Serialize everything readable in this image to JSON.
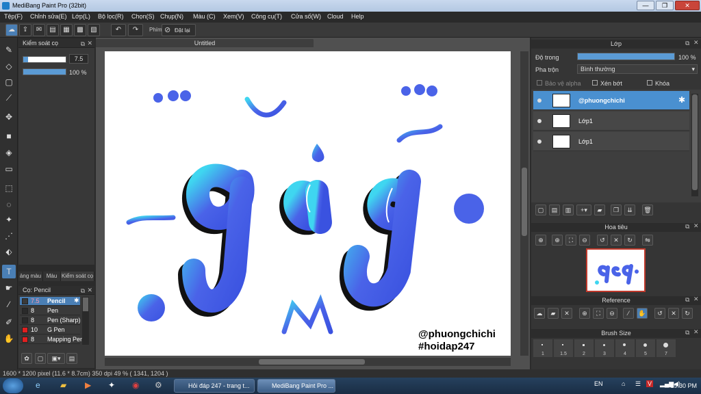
{
  "app": {
    "title": "MediBang Paint Pro (32bit)",
    "window_buttons": [
      "—",
      "❐",
      "✕"
    ]
  },
  "menu": [
    "Tệp(F)",
    "Chỉnh sửa(E)",
    "Lớp(L)",
    "Bộ lọc(R)",
    "Chọn(S)",
    "Chụp(N)",
    "Màu (C)",
    "Xem(V)",
    "Công cụ(T)",
    "Cửa số(W)",
    "Cloud",
    "Help"
  ],
  "toolbar": {
    "phim_label": "Phím",
    "reset_label": "Đặt lại"
  },
  "brush_control": {
    "title": "Kiểm soát cọ",
    "size_value": "7.5",
    "opacity_value": "100 %"
  },
  "left_tabs": [
    "ảng màu",
    "Màu",
    "Kiểm soát cọ"
  ],
  "brush_panel": {
    "title": "Cọ: Pencil",
    "items": [
      {
        "size": "7.5",
        "name": "Pencil",
        "color": "#3a3a3a"
      },
      {
        "size": "8",
        "name": "Pen",
        "color": "#2a2a2a"
      },
      {
        "size": "8",
        "name": "Pen (Sharp)",
        "color": "#2a2a2a"
      },
      {
        "size": "10",
        "name": "G Pen",
        "color": "#e02020"
      },
      {
        "size": "8",
        "name": "Mapping Pen",
        "color": "#e02020"
      }
    ]
  },
  "document": {
    "tab_title": "Untitled",
    "watermark_line1": "@phuongchichi",
    "watermark_line2": "#hoidap247"
  },
  "layer_panel": {
    "title": "Lớp",
    "opacity_label": "Độ trong",
    "opacity_value": "100 %",
    "opacity_fraction": 1.0,
    "blend_label": "Pha trộn",
    "blend_value": "Bình thường",
    "protect_alpha": "Bảo vệ alpha",
    "clip_label": "Xén bớt",
    "lock_label": "Khóa",
    "layers": [
      {
        "name": "@phuongchichi",
        "selected": true
      },
      {
        "name": "Lớp1",
        "selected": false
      },
      {
        "name": "Lớp1",
        "selected": false
      }
    ]
  },
  "navigator": {
    "title": "Hoa tiêu"
  },
  "reference": {
    "title": "Reference"
  },
  "brush_size": {
    "title": "Brush Size",
    "values": [
      "1",
      "1.5",
      "2",
      "3",
      "4",
      "5",
      "7"
    ]
  },
  "status": {
    "dimensions": "1600 * 1200 pixel  (11.6 * 8.7cm)  350 dpi  49 %  ( 1341, 1204 )"
  },
  "taskbar": {
    "tasks": [
      "Hỏi đáp 247 - trang t...",
      "MediBang Paint Pro ..."
    ],
    "language": "EN",
    "time": "19:30 PM"
  },
  "colors": {
    "accent": "#4a90d0",
    "letter_blue": "#4a63e8",
    "letter_cyan": "#3fd6f0"
  }
}
